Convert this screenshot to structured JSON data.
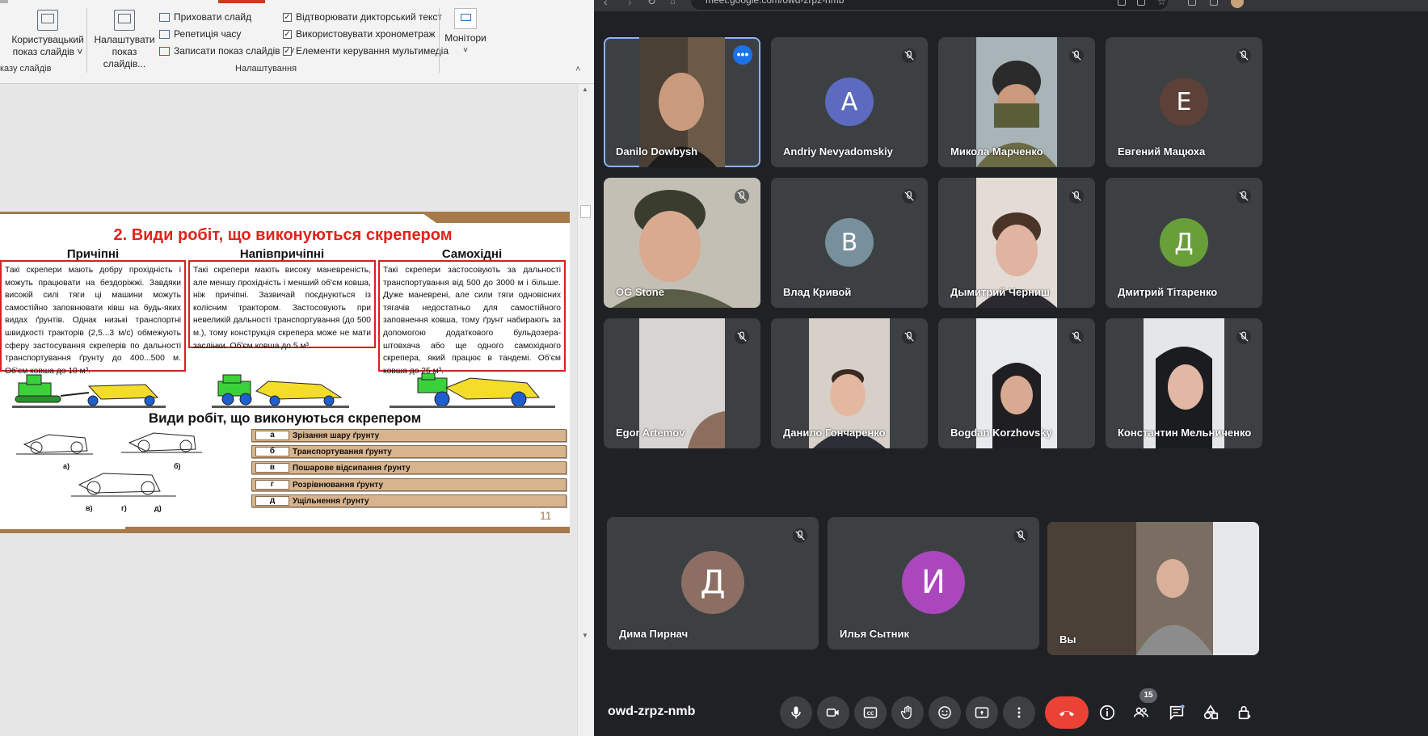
{
  "ppt": {
    "ribbon": {
      "custom_show": {
        "line1": "Користувацький",
        "line2": "показ слайдів ˅"
      },
      "setup_show": {
        "line1": "Налаштувати",
        "line2": "показ слайдів..."
      },
      "hide_slide": "Приховати слайд",
      "rehearse_timings": "Репетиція часу",
      "record_show": "Записати показ слайдів",
      "record_show_arrow": "˅",
      "play_narrations": "Відтворювати дикторський текст",
      "use_timings": "Використовувати хронометраж",
      "media_controls": "Елементи керування мультимедіа",
      "monitors": "Монітори",
      "monitors_arrow": "˅",
      "group_start_show": "казу слайдів",
      "group_setup": "Налаштування",
      "collapse": "˄"
    },
    "slide": {
      "title": "2. Види робіт, що виконуються скрепером",
      "col1_head": "Причіпні",
      "col1_text": "Такі скрепери мають добру прохідність і можуть працювати на бездоріжжі. Завдяки високій силі тяги ці машини можуть самостійно заповнювати ківш на будь-яких видах ґрунтів. Однак низькі транспортні швидкості тракторів (2,5...3 м/с) обмежують сферу застосування скреперів по дальності транспортування ґрунту до 400...500 м. Об'єм ковша до 10 м³.",
      "col2_head": "Напівпричіпні",
      "col2_text": "Такі скрепери мають високу маневреність, але меншу прохідність і менший об'єм ковша, ніж причіпні. Зазвичай поєднуються із колісним трактором. Застосовують при невеликій дальності транспортування (до 500 м.), тому конструкція скрепера може не мати заслінки. Об'єм ковша до 5 м³.",
      "col3_head": "Самохідні",
      "col3_text": "Такі скрепери застосовують за дальності транспортування від 500 до 3000 м і більше. Дуже маневрені, але сили тяги одновісних тягачів недостатньо для самостійного заповнення ковша, тому ґрунт набирають за допомогою додаткового бульдозера-штовхача або ще одного самохідного скрепера, який працює в тандемі. Об'єм ковша до 25 м³.",
      "subtitle": "Види робіт, що виконуються скрепером",
      "operations": [
        {
          "letter": "а",
          "text": "Зрізання шару ґрунту"
        },
        {
          "letter": "б",
          "text": "Транспортування ґрунту"
        },
        {
          "letter": "в",
          "text": "Пошарове відсипання ґрунту"
        },
        {
          "letter": "г",
          "text": "Розрівнювання ґрунту"
        },
        {
          "letter": "д",
          "text": "Ущільнення ґрунту"
        }
      ],
      "diagram_labels": {
        "a": "а)",
        "b": "б)",
        "v": "в)",
        "g": "г)",
        "d": "д)"
      },
      "page_number": "11"
    }
  },
  "meet": {
    "url": "meet.google.com/owd-zrpz-nmb",
    "meeting_code": "owd-zrpz-nmb",
    "participant_count": "15",
    "more_options": "•••",
    "participants": [
      {
        "name": "Danilo Dowbysh"
      },
      {
        "name": "Andriy Nevyadomskiy",
        "initial": "A",
        "color": "#5c6bc0"
      },
      {
        "name": "Микола Марченко"
      },
      {
        "name": "Евгений Мацюха",
        "initial": "Е",
        "color": "#5d4037"
      },
      {
        "name": "OG Stone"
      },
      {
        "name": "Влад Кривой",
        "initial": "В",
        "color": "#78909c"
      },
      {
        "name": "Дымитрий Черниш"
      },
      {
        "name": "Дмитрий Тітаренко",
        "initial": "Д",
        "color": "#689f38"
      },
      {
        "name": "Egor Artemov"
      },
      {
        "name": "Данило Гончаренко"
      },
      {
        "name": "Bogdan Korzhovsky"
      },
      {
        "name": "Константин Мельниченко"
      },
      {
        "name": "Дима Пирнач",
        "initial": "Д",
        "color": "#8d6e63"
      },
      {
        "name": "Илья Сытник",
        "initial": "И",
        "color": "#ab47bc"
      },
      {
        "name": "Вы"
      }
    ]
  }
}
